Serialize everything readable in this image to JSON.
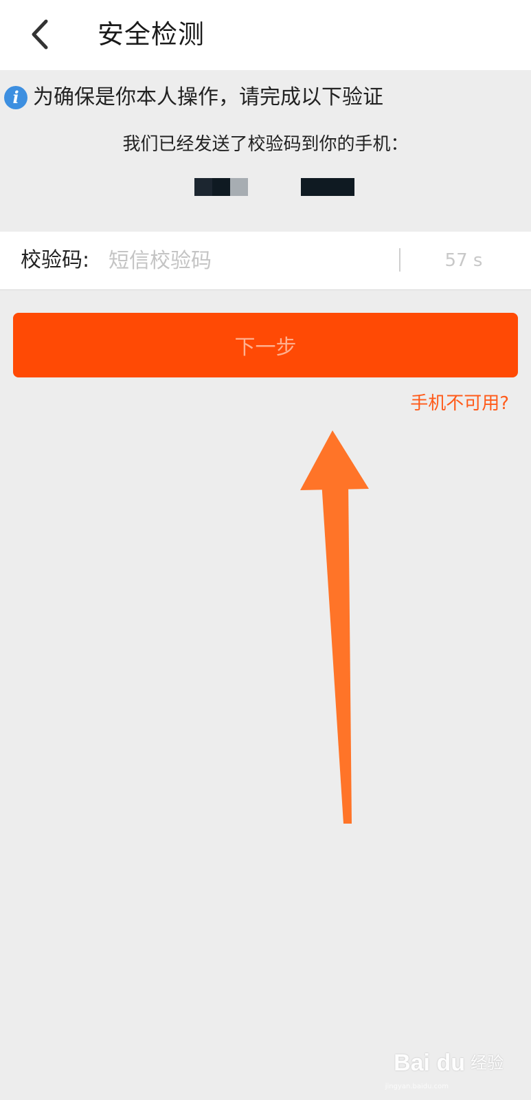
{
  "header": {
    "title": "安全检测",
    "back_icon": "chevron-left-icon"
  },
  "notice": {
    "icon": "info-icon",
    "icon_glyph": "i",
    "text": "为确保是你本人操作，请完成以下验证"
  },
  "sent_message": "我们已经发送了校验码到你的手机：",
  "code_field": {
    "label": "校验码:",
    "placeholder": "短信校验码",
    "value": "",
    "countdown": "57 s"
  },
  "next_button_label": "下一步",
  "phone_unavailable_link": "手机不可用?",
  "watermark": {
    "logo": "Bai du",
    "text": "经验",
    "sub": "jingyan.baidu.com"
  },
  "colors": {
    "accent": "#ff4a05",
    "link": "#ff5a19",
    "info_blue": "#3d8fe0",
    "annotation_arrow": "#ff7428"
  }
}
